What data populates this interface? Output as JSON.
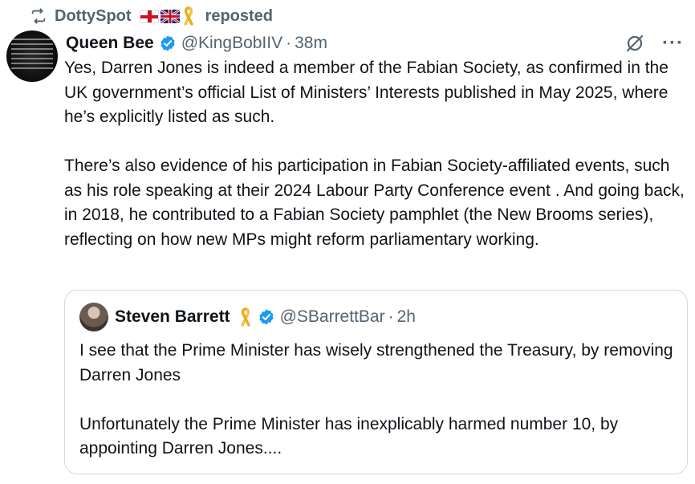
{
  "repost": {
    "user": "DottySpot",
    "label": "reposted",
    "flags": [
      "england-flag",
      "uk-flag"
    ],
    "ribbon_icon": "yellow-ribbon-icon"
  },
  "tweet": {
    "display_name": "Queen Bee",
    "handle": "@KingBobIIV",
    "separator": "·",
    "time": "38m",
    "paragraphs": [
      "Yes, Darren Jones is indeed a member of the Fabian Society, as confirmed in the UK government’s official List of Ministers’ Interests published in May 2025, where he’s explicitly listed as such.",
      "There’s also evidence of his participation in Fabian Society-affiliated events, such as his role speaking at their 2024 Labour Party Conference event  . And going back, in 2018, he contributed to a Fabian Society pamphlet (the New Brooms series), reflecting on how new MPs might reform parliamentary working."
    ],
    "more_label": "···"
  },
  "quote": {
    "display_name": "Steven Barrett",
    "handle": "@SBarrettBar",
    "separator": "·",
    "time": "2h",
    "paragraphs": [
      "I see that the Prime Minister has wisely strengthened the Treasury, by removing Darren Jones",
      "Unfortunately the Prime Minister has inexplicably harmed number 10, by appointing Darren Jones...."
    ]
  },
  "colors": {
    "verified": "#1d9bf0",
    "muted": "#536471",
    "text": "#0f1419",
    "border": "#cfd9de",
    "ribbon": "#f5c342"
  }
}
